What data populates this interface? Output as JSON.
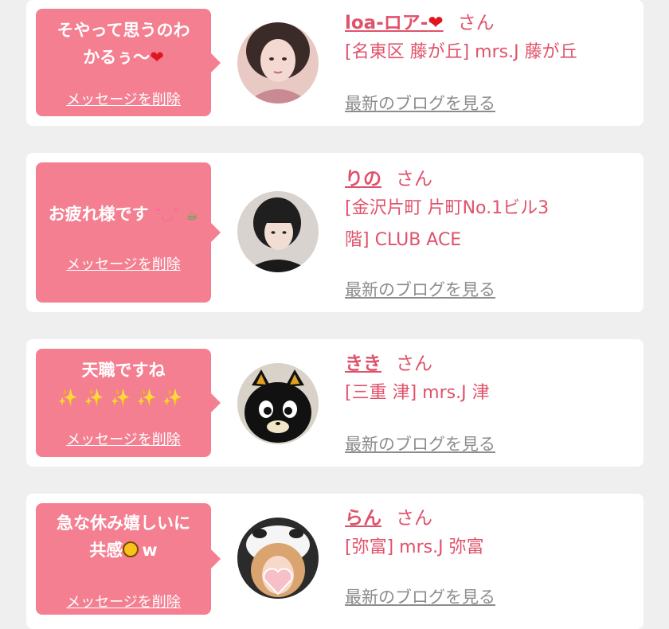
{
  "colors": {
    "background": "#efefef",
    "card": "#ffffff",
    "bubble": "#f47f91",
    "accent": "#e0526b",
    "link_gray": "#8c8c8c"
  },
  "delete_label": "メッセージを削除",
  "honorific": "さん",
  "blog_label": "最新のブログを見る",
  "items": [
    {
      "message_line1": "そやって思うのわ",
      "message_line2": "かるぅ〜",
      "message_emoji": "❤",
      "name": "loa-ロア-",
      "name_emoji": "❤",
      "shop_line1": "[名東区 藤が丘] mrs.J 藤が丘",
      "shop_line2": "",
      "avatar_icon": "woman-photo-icon"
    },
    {
      "message_line1": "お疲れ様です",
      "message_emoji1": "˘◡˘",
      "message_emoji2": "☕",
      "name": "りの",
      "shop_line1": "[金沢片町 片町No.1ビル3",
      "shop_line2": "階] CLUB ACE",
      "avatar_icon": "woman-photo-icon"
    },
    {
      "message_line1": "天職ですね",
      "message_line2": "✨✨✨✨✨",
      "name": "きき",
      "shop_line1": "[三重 津] mrs.J 津",
      "shop_line2": "",
      "avatar_icon": "black-cat-icon"
    },
    {
      "message_line1": "急な休み嬉しいに",
      "message_line2a": "共感",
      "message_line2b": "w",
      "name": "らん",
      "shop_line1": "[弥富] mrs.J 弥富",
      "shop_line2": "",
      "avatar_icon": "woman-photo-icon"
    }
  ]
}
